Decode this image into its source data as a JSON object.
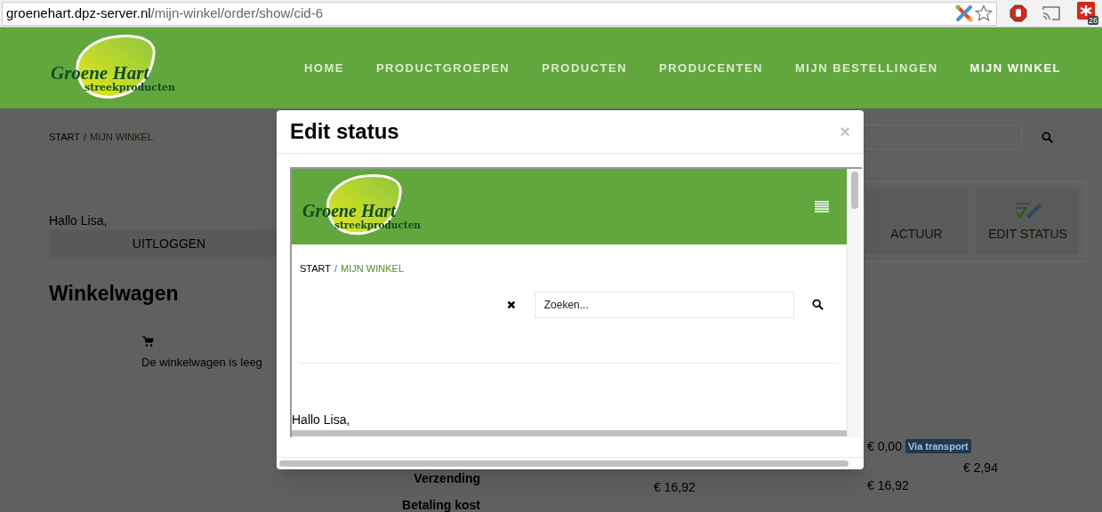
{
  "browser": {
    "url_host": "groenehart.dpz-server.nl",
    "url_path": "/mijn-winkel/order/show/cid-6",
    "extension_badge": "26"
  },
  "site_header": {
    "logo": {
      "script": "Groene Hart",
      "tagline": "streekproducten"
    },
    "nav": [
      {
        "label": "HOME",
        "selected": false
      },
      {
        "label": "PRODUCTGROEPEN",
        "selected": false
      },
      {
        "label": "PRODUCTEN",
        "selected": false
      },
      {
        "label": "PRODUCENTEN",
        "selected": false
      },
      {
        "label": "MIJN BESTELLINGEN",
        "selected": false
      },
      {
        "label": "MIJN WINKEL",
        "selected": true
      }
    ]
  },
  "page": {
    "breadcrumb": [
      {
        "label": "START",
        "current": false
      },
      {
        "separator": "/",
        "label": "MIJN WINKEL",
        "current": true
      }
    ],
    "greeting": "Hallo Lisa,",
    "logout_button": "UITLOGGEN",
    "cart_title": "Winkelwagen",
    "cart_empty": "De winkelwagen is leeg",
    "tiles": [
      {
        "label": "ACTUUR"
      },
      {
        "label": "EDIT STATUS"
      }
    ],
    "summary": {
      "labels": [
        "Verzending",
        "Betaling kost"
      ],
      "column_2": [
        "€ 16,92"
      ],
      "column_3": [
        {
          "amount": "€ 0,00",
          "badge": "Via transport"
        },
        {
          "amount": "€ 16,92"
        }
      ],
      "column_4": [
        "€ 2,94"
      ]
    }
  },
  "modal": {
    "title": "Edit status",
    "close": "×",
    "frame": {
      "logo": {
        "script": "Groene Hart",
        "tagline": "streekproducten"
      },
      "breadcrumb": [
        {
          "label": "START",
          "current": false
        },
        {
          "separator": "/",
          "label": "MIJN WINKEL",
          "current": true
        }
      ],
      "search_placeholder": "Zoeken...",
      "greeting": "Hallo Lisa,"
    }
  }
}
